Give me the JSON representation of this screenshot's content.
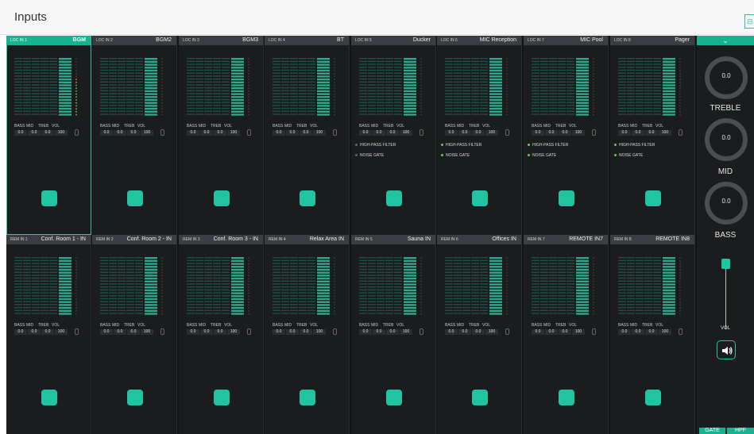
{
  "page": {
    "title": "Inputs"
  },
  "header_button_glyph": "⊟",
  "strip_labels": [
    "BASS",
    "MID",
    "TREB",
    "VOL"
  ],
  "strip_values": [
    "0.0",
    "0.0",
    "0.0",
    "100"
  ],
  "options": {
    "hpf": "HIGH-PASS FILTER",
    "gate": "NOISE GATE"
  },
  "colors": {
    "accent": "#20c4a0",
    "header_selected": "#17b28f",
    "meter": "#2fa88c",
    "meter_dim": "#1f4f46",
    "led_green": "#5fcf55",
    "led_orange": "#e38a26"
  },
  "selected_level": 0.65,
  "loc_channels": [
    {
      "id": "LOC IN 1",
      "name": "BGM",
      "selected": true,
      "has_options": false
    },
    {
      "id": "LOC IN 2",
      "name": "BGM2",
      "selected": false,
      "has_options": false
    },
    {
      "id": "LOC IN 3",
      "name": "BGM3",
      "selected": false,
      "has_options": false
    },
    {
      "id": "LOC IN 4",
      "name": "BT",
      "selected": false,
      "has_options": false
    },
    {
      "id": "LOC IN 5",
      "name": "Ducker",
      "selected": false,
      "has_options": true,
      "hpf_on": false,
      "gate_on": false
    },
    {
      "id": "LOC IN 6",
      "name": "MIC Reception",
      "selected": false,
      "has_options": true,
      "hpf_on": true,
      "gate_on": true
    },
    {
      "id": "LOC IN 7",
      "name": "MIC Pool",
      "selected": false,
      "has_options": true,
      "hpf_on": true,
      "gate_on": true
    },
    {
      "id": "LOC IN 8",
      "name": "Pager",
      "selected": false,
      "has_options": true,
      "hpf_on": true,
      "gate_on": true
    }
  ],
  "rem_channels": [
    {
      "id": "REM IN 1",
      "name": "Conf. Room 1 - IN"
    },
    {
      "id": "REM IN 2",
      "name": "Conf. Room 2 - IN"
    },
    {
      "id": "REM IN 3",
      "name": "Conf. Room 3 - IN"
    },
    {
      "id": "REM IN 4",
      "name": "Relax Area IN"
    },
    {
      "id": "REM IN 5",
      "name": "Sauna IN"
    },
    {
      "id": "REM IN 6",
      "name": "Offices IN"
    },
    {
      "id": "REM IN 7",
      "name": "REMOTE IN7"
    },
    {
      "id": "REM IN 8",
      "name": "REMOTE IN8"
    }
  ],
  "right_panel": {
    "collapse_glyph": "⌄",
    "knobs": [
      {
        "label": "TREBLE",
        "value": "0.0"
      },
      {
        "label": "MID",
        "value": "0.0"
      },
      {
        "label": "BASS",
        "value": "0.0"
      }
    ],
    "volume_label": "VOL",
    "volume_level": 0.95,
    "gate_button": "GATE",
    "hpf_button": "HPF"
  }
}
